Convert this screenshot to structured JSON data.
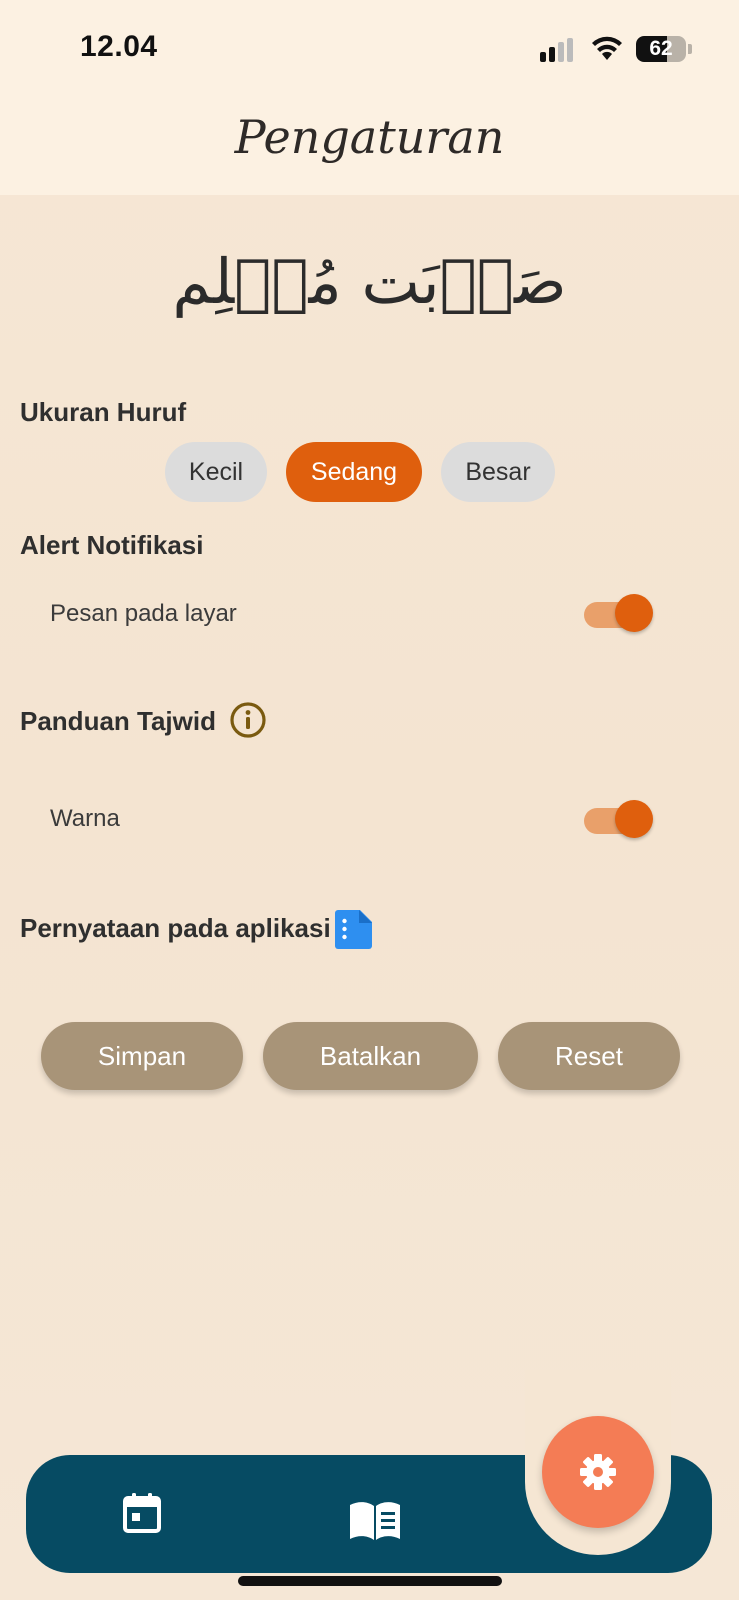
{
  "status_bar": {
    "time": "12.04",
    "battery_percent": "62",
    "battery_level": 0.62,
    "signal_icon": "cellular-signal-icon",
    "wifi_icon": "wifi-icon"
  },
  "header": {
    "title": "Pengaturan"
  },
  "logo": {
    "text": "صَوۡبَت مُسۡلِم"
  },
  "font_size": {
    "title": "Ukuran Huruf",
    "options": [
      "Kecil",
      "Sedang",
      "Besar"
    ],
    "selected": "Sedang"
  },
  "notification": {
    "title": "Alert Notifikasi",
    "item_label": "Pesan pada layar",
    "enabled": true
  },
  "tajwid": {
    "title": "Panduan Tajwid",
    "info_icon": "info-icon",
    "item_label": "Warna",
    "enabled": true
  },
  "statement": {
    "title": "Pernyataan pada aplikasi",
    "icon": "document-icon"
  },
  "actions": {
    "save": "Simpan",
    "cancel": "Batalkan",
    "reset": "Reset"
  },
  "bottom_nav": {
    "items": [
      {
        "icon": "calendar-icon"
      },
      {
        "icon": "book-icon"
      },
      {
        "icon": "settings-gear-icon",
        "active": true
      }
    ]
  },
  "colors": {
    "accent": "#df5f0d",
    "nav_bg": "#064b63",
    "fab": "#f47c55",
    "button": "#a89478",
    "background": "#f5e6d3"
  }
}
